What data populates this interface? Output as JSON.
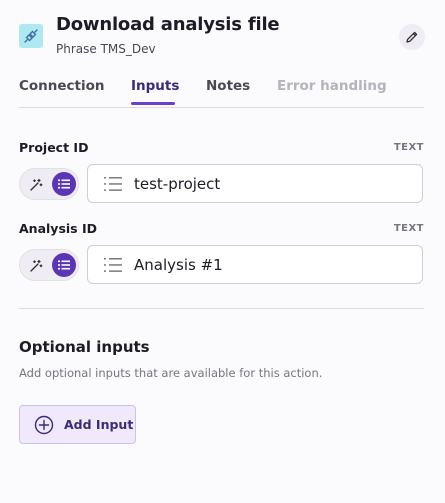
{
  "header": {
    "title": "Download analysis file",
    "subtitle": "Phrase TMS_Dev",
    "app_icon": "plug-icon",
    "edit_icon": "pencil-icon"
  },
  "tabs": [
    {
      "label": "Connection",
      "state": "normal"
    },
    {
      "label": "Inputs",
      "state": "active"
    },
    {
      "label": "Notes",
      "state": "normal"
    },
    {
      "label": "Error handling",
      "state": "disabled"
    }
  ],
  "fields": [
    {
      "label": "Project ID",
      "type": "TEXT",
      "value": "test-project"
    },
    {
      "label": "Analysis ID",
      "type": "TEXT",
      "value": "Analysis #1"
    }
  ],
  "optional": {
    "title": "Optional inputs",
    "description": "Add optional inputs that are available for this action.",
    "add_button_label": "Add Input"
  },
  "colors": {
    "accent": "#5a35b5",
    "app_icon_bg": "#aee9f2",
    "add_button_bg": "#efe9fb"
  }
}
